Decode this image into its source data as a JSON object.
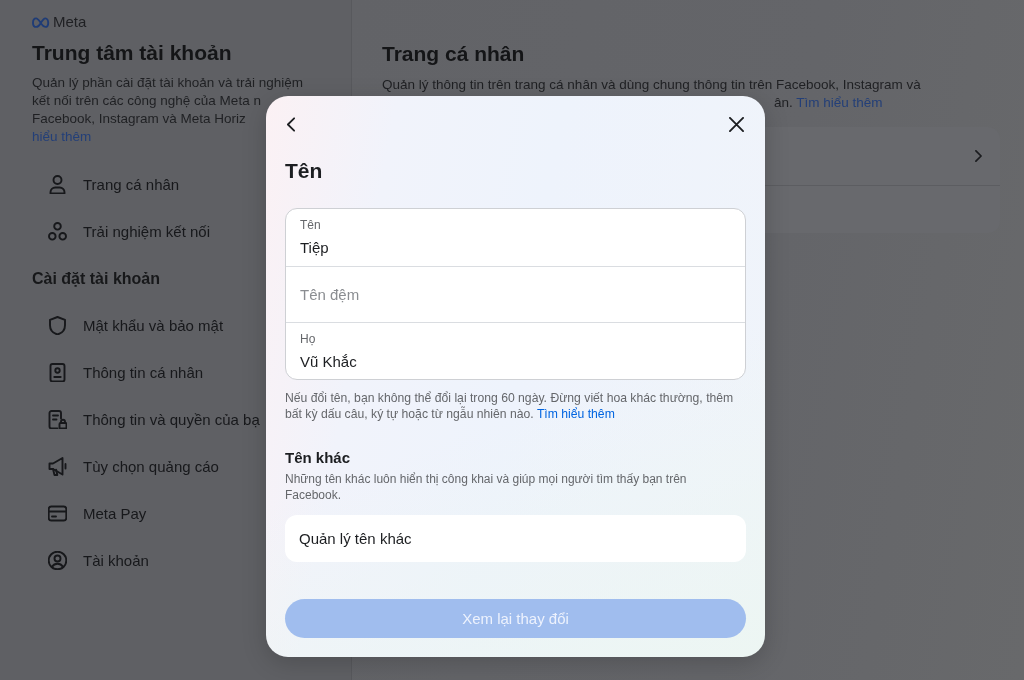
{
  "background": {
    "sidebar": {
      "brand": "Meta",
      "title": "Trung tâm tài khoản",
      "description_lines": [
        "Quản lý phần cài đặt tài khoản và trải nghiệm",
        "kết nối trên các công nghệ của Meta n",
        "Facebook, Instagram và Meta Horiz"
      ],
      "learn_more_link": "hiểu thêm",
      "items": [
        {
          "label": "Trang cá nhân"
        },
        {
          "label": "Trải nghiệm kết nối"
        }
      ],
      "settings_section": {
        "heading": "Cài đặt tài khoản",
        "items": [
          {
            "label": "Mật khẩu và bảo mật"
          },
          {
            "label": "Thông tin cá nhân"
          },
          {
            "label": "Thông tin và quyền của bạ"
          },
          {
            "label": "Tùy chọn quảng cáo"
          },
          {
            "label": "Meta Pay"
          },
          {
            "label": "Tài khoản"
          }
        ]
      }
    },
    "main": {
      "title": "Trang cá nhân",
      "description_line": "Quản lý thông tin trên trang cá nhân và dùng chung thông tin trên Facebook, Instagram và",
      "description_tail": "ân.",
      "learn_more_link": "Tìm hiểu thêm"
    }
  },
  "dialog": {
    "title": "Tên",
    "name_fields": [
      {
        "label": "Tên",
        "value": "Tiệp"
      },
      {
        "placeholder": "Tên đệm"
      },
      {
        "label": "Họ",
        "value": "Vũ Khắc"
      }
    ],
    "notice": "Nếu đổi tên, bạn không thể đổi lại trong 60 ngày. Đừng viết hoa khác thường, thêm bất kỳ dấu câu, ký tự hoặc từ ngẫu nhiên nào.",
    "notice_link": "Tìm hiểu thêm",
    "other_names": {
      "title": "Tên khác",
      "description": "Những tên khác luôn hiển thị công khai và giúp mọi người tìm thấy bạn trên Facebook.",
      "manage_button": "Quản lý tên khác"
    },
    "review_button": {
      "label": "Xem lại thay đổi",
      "disabled": true
    }
  }
}
